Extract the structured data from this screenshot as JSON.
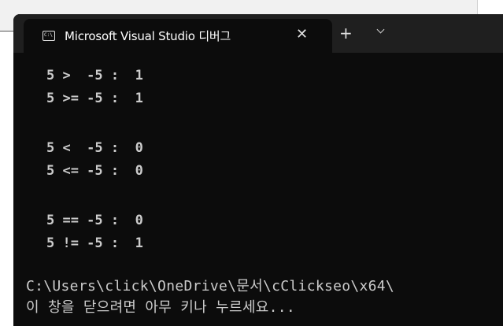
{
  "tab": {
    "icon": "terminal-icon",
    "title": "Microsoft Visual Studio 디버그",
    "close": "✕",
    "new_tab": "+"
  },
  "output": [
    "5 >  -5 :  1",
    "5 >= -5 :  1",
    "5 <  -5 :  0",
    "5 <= -5 :  0",
    "5 == -5 :  0",
    "5 != -5 :  1"
  ],
  "path": "C:\\Users\\click\\OneDrive\\문서\\cClickseo\\x64\\",
  "close_prompt": "이 창을 닫으려면 아무 키나 누르세요..."
}
